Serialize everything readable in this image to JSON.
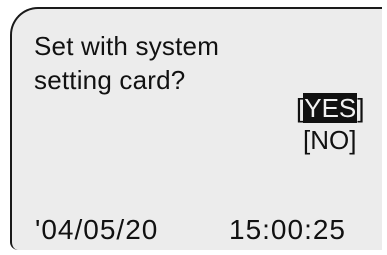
{
  "prompt": {
    "line1": "Set with system",
    "line2": "setting card?"
  },
  "options": {
    "yes_label": "YES",
    "no_label": "NO",
    "open_bracket": "[",
    "close_bracket": "]"
  },
  "status": {
    "date": "'04/05/20",
    "time": "15:00:25"
  },
  "colors": {
    "screen_bg": "#ececec",
    "text": "#111111",
    "selection_bg": "#111111",
    "selection_fg": "#f2f2f2"
  }
}
